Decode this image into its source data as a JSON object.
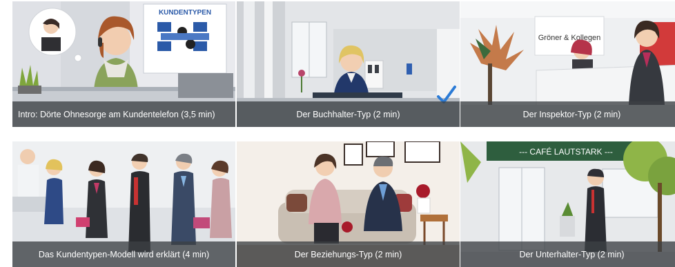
{
  "tiles": [
    {
      "caption": "Intro: Dörte Ohnesorge am Kundentelefon (3,5 min)",
      "poster_title": "KUNDENTYPEN"
    },
    {
      "caption": "Der Buchhalter-Typ (2 min)",
      "completed": true
    },
    {
      "caption": "Der Inspektor-Typ (2 min)",
      "sign_text": "Gröner & Kollegen"
    },
    {
      "caption": "Das Kundentypen-Modell wird erklärt (4 min)"
    },
    {
      "caption": "Der Beziehungs-Typ (2 min)"
    },
    {
      "caption": "Der Unterhalter-Typ (2 min)",
      "sign_text": "--- CAFÉ LAUTSTARK ---"
    }
  ],
  "colors": {
    "caption_bg": "#3c4044",
    "check": "#2b7bd6",
    "cafe_sign": "#2e5e3e",
    "office_red": "#d23a3a"
  }
}
